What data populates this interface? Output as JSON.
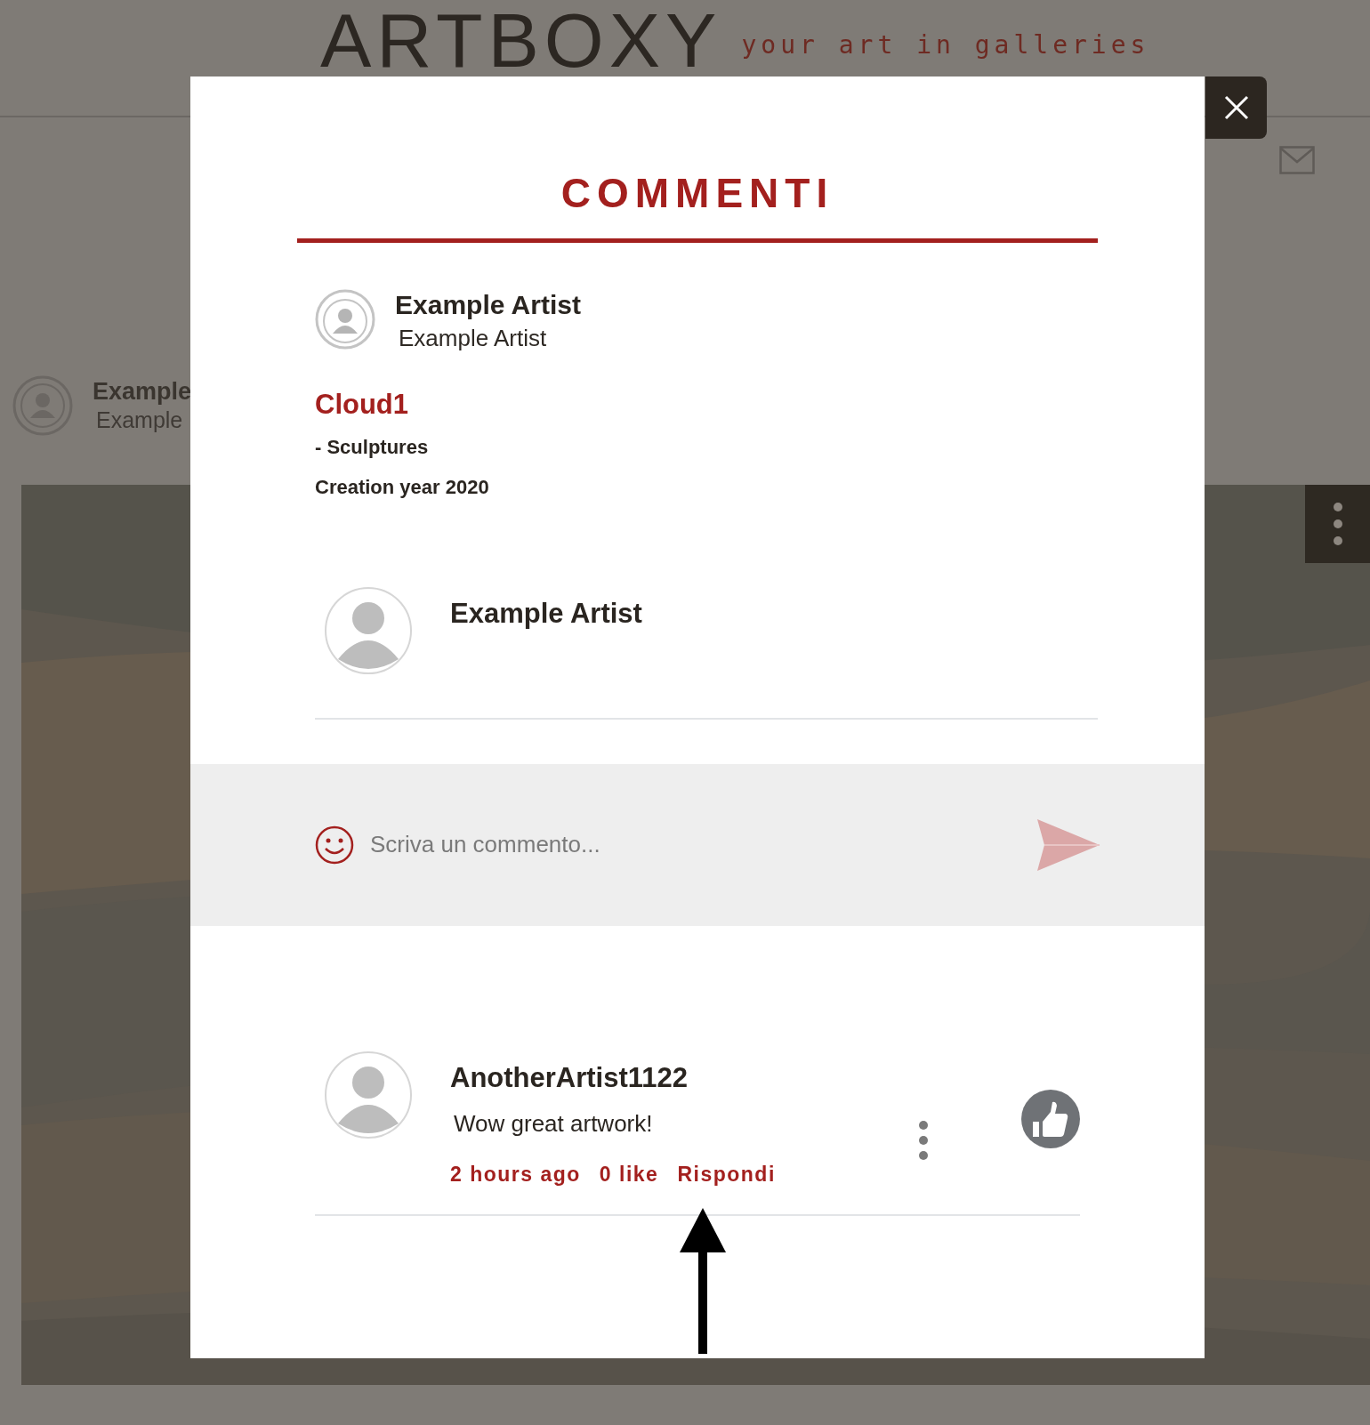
{
  "header": {
    "logo": "ARTBOXY",
    "tagline": "your art in galleries"
  },
  "background": {
    "author_name": "Example",
    "author_sub": "Example"
  },
  "modal": {
    "title": "COMMENTI",
    "artwork": {
      "artist_name": "Example Artist",
      "artist_sub": "Example Artist",
      "title": "Cloud1",
      "category": "- Sculptures",
      "year": "Creation year 2020"
    },
    "current_user": {
      "name": "Example Artist"
    },
    "comment_input": {
      "placeholder": "Scriva un commento..."
    },
    "comments": [
      {
        "author": "AnotherArtist1122",
        "text": "Wow great artwork!",
        "time": "2 hours ago",
        "likes": "0 like",
        "reply": "Rispondi"
      }
    ]
  }
}
